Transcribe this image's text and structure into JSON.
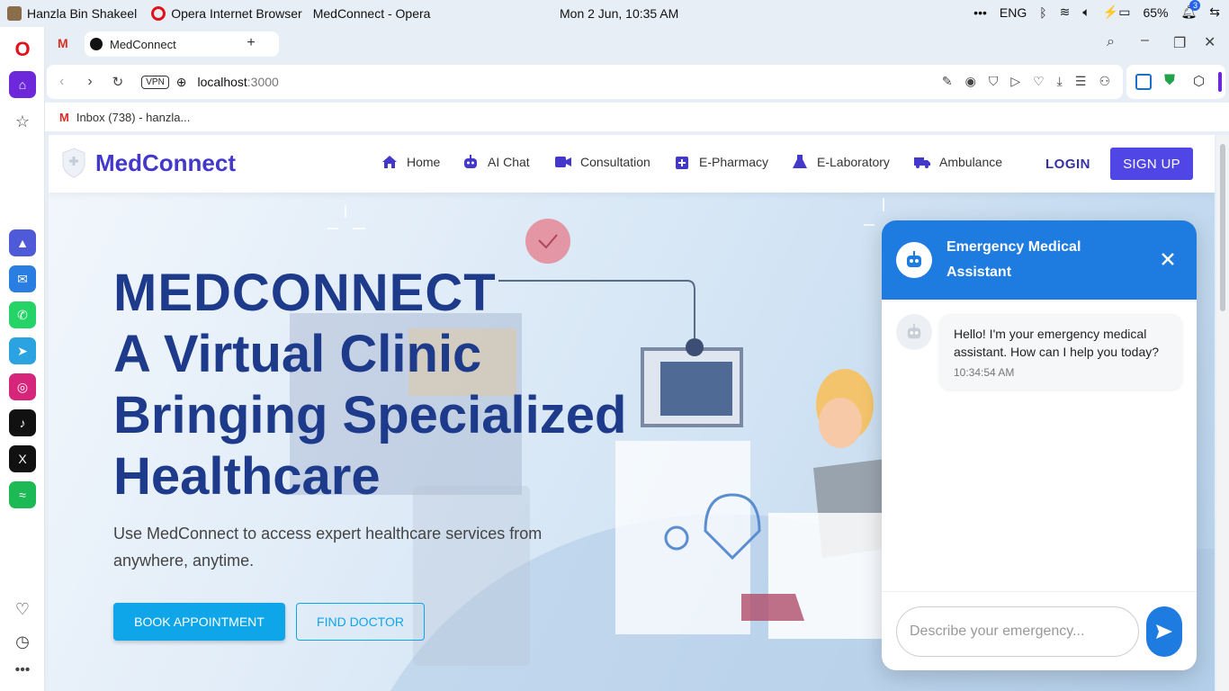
{
  "os": {
    "user": "Hanzla Bin Shakeel",
    "app": "Opera Internet Browser",
    "window_title": "MedConnect - Opera",
    "clock": "Mon 2 Jun, 10:35 AM",
    "lang": "ENG",
    "battery": "65%",
    "notif_count": "3"
  },
  "browser": {
    "tab_title": "MedConnect",
    "url_host": "localhost",
    "url_port": ":3000",
    "vpn_label": "VPN",
    "bookmark_label": "Inbox (738) - hanzla..."
  },
  "site": {
    "brand": "MedConnect",
    "nav": [
      {
        "label": "Home"
      },
      {
        "label": "AI Chat"
      },
      {
        "label": "Consultation"
      },
      {
        "label": "E-Pharmacy"
      },
      {
        "label": "E-Laboratory"
      },
      {
        "label": "Ambulance"
      }
    ],
    "login": "LOGIN",
    "signup": "SIGN UP",
    "hero": {
      "line1": "MEDCONNECT",
      "line2": "A Virtual Clinic",
      "line3": "Bringing Specialized",
      "line4": "Healthcare",
      "desc": "Use MedConnect to access expert healthcare services from anywhere, anytime.",
      "btn_book": "BOOK APPOINTMENT",
      "btn_find": "FIND DOCTOR"
    }
  },
  "chat": {
    "title": "Emergency Medical Assistant",
    "message": "Hello! I'm your emergency medical assistant. How can I help you today?",
    "time": "10:34:54 AM",
    "placeholder": "Describe your emergency..."
  },
  "colors": {
    "brand": "#4338ca",
    "primary": "#4f46e5",
    "chat_header": "#1e7be0",
    "hero_text": "#1e3a8a",
    "cta": "#0ea5e9"
  }
}
